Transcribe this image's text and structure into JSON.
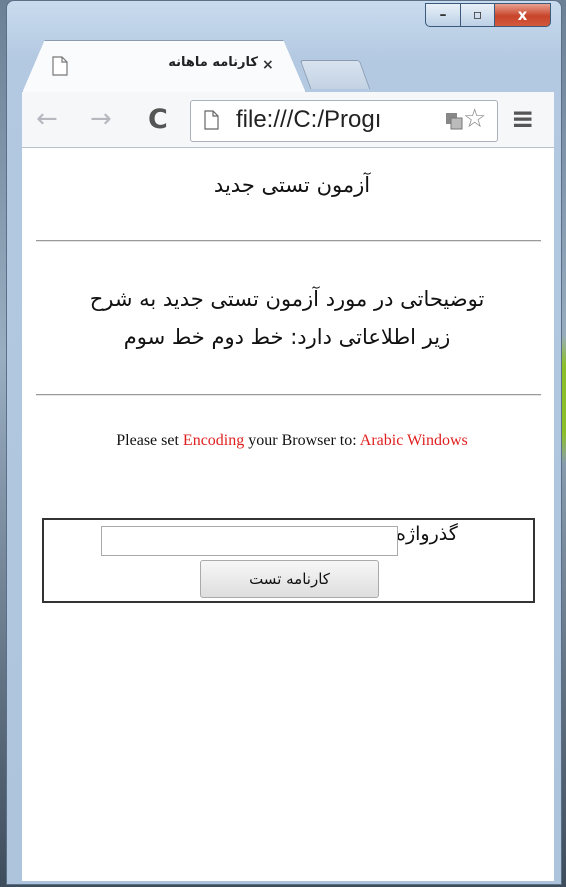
{
  "browser": {
    "tab_title": "کارنامه ماهانه",
    "tab_close": "×",
    "url": "file:///C:/Progı",
    "nav": {
      "back": "←",
      "forward": "→",
      "reload": "C",
      "menu": "≡",
      "star": "☆"
    },
    "window_controls": {
      "minimize": "–",
      "maximize": "▫",
      "close": "x"
    }
  },
  "page": {
    "heading": "آزمون تستی جدید",
    "description_line1": "توضیحاتی در مورد آزمون تستی جدید به شرح",
    "description_line2": "زیر اطلاعاتی دارد: خط دوم خط سوم",
    "notice": {
      "part1": "Please set ",
      "part2": "Encoding",
      "part3": " your Browser to: ",
      "part4": "Arabic Windows"
    },
    "form": {
      "password_label": "گذرواژه",
      "password_value": "",
      "submit_label": "کارنامه تست"
    }
  },
  "colors": {
    "accent_red": "#e02020",
    "window_frame": "#b3c9e1",
    "close_button": "#c7442a"
  }
}
